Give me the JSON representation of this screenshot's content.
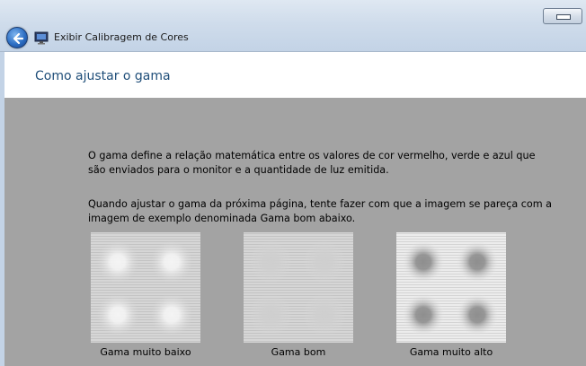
{
  "window": {
    "title": "Exibir Calibragem de Cores",
    "icons": {
      "back": "back-arrow-icon",
      "app": "display-calibration-icon",
      "close": "close-icon"
    }
  },
  "header": {
    "title": "Como ajustar o gama"
  },
  "content": {
    "paragraph1": "O gama define a relação matemática entre os valores de cor vermelho, verde e azul que são enviados para o monitor e a quantidade de luz emitida.",
    "paragraph2": "Quando ajustar o gama da próxima página, tente fazer com que a imagem se pareça com a imagem de exemplo denominada Gama bom abaixo."
  },
  "samples": [
    {
      "label": "Gama muito baixo",
      "kind": "low",
      "bg": "#d6d6d6",
      "dot": "#f4f4f4"
    },
    {
      "label": "Gama bom",
      "kind": "good",
      "bg": "#d6d6d6",
      "dot": "#cfcfcf"
    },
    {
      "label": "Gama muito alto",
      "kind": "high",
      "bg": "#ececec",
      "dot": "#8e8e8e"
    }
  ],
  "colors": {
    "background": "#a3a3a3",
    "header_bg": "#ffffff",
    "title_color": "#1f4e79",
    "chrome": "#cfdceb"
  }
}
